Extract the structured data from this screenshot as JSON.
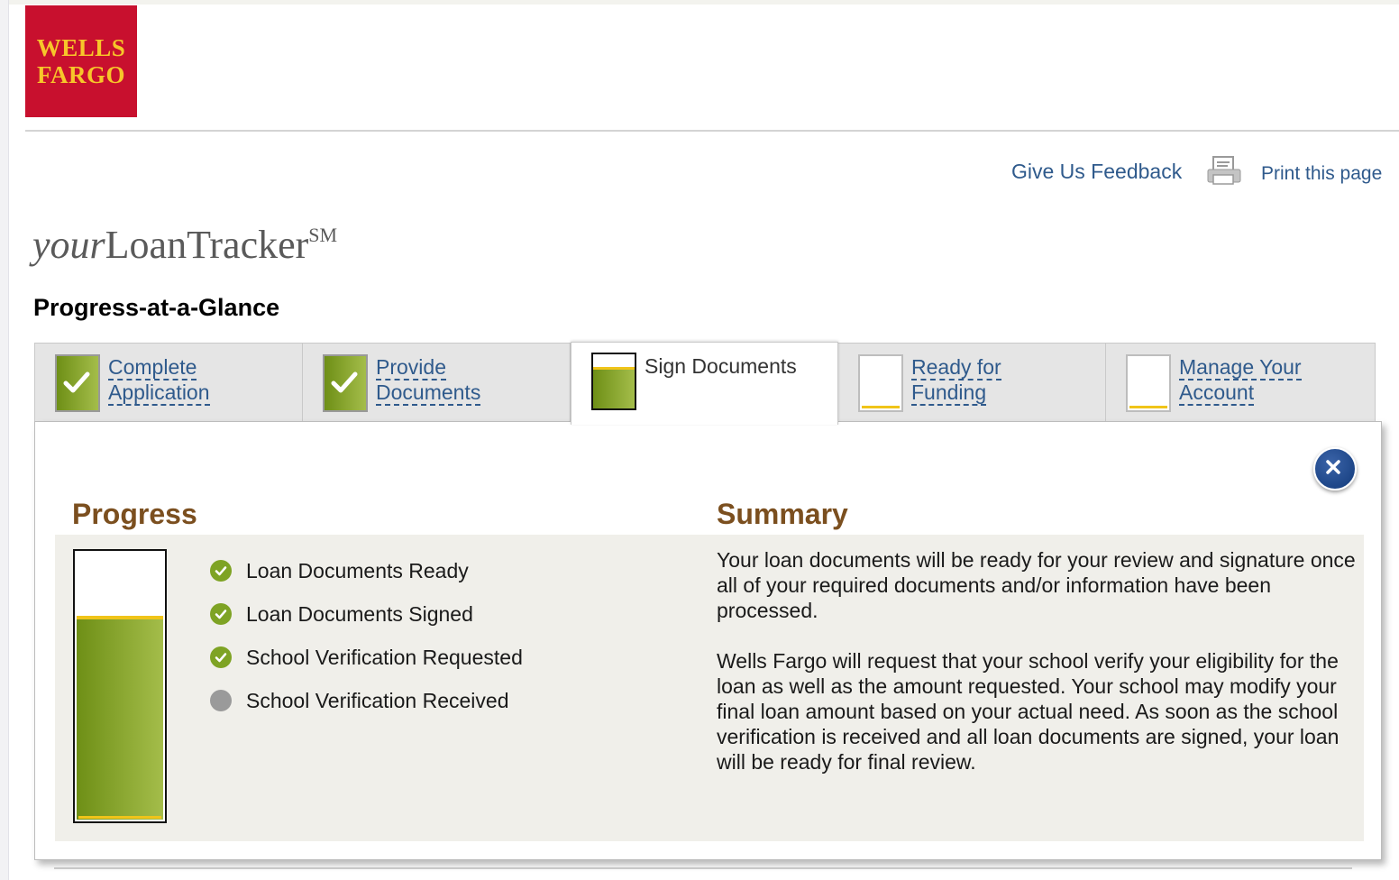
{
  "brand": {
    "logo_line1": "WELLS",
    "logo_line2": "FARGO"
  },
  "header": {
    "feedback_label": "Give Us Feedback",
    "print_label": "Print this page",
    "print_icon": "printer-icon"
  },
  "app": {
    "title_italic": "your",
    "title_main": "LoanTracker",
    "title_mark": "SM"
  },
  "glance": {
    "title": "Progress-at-a-Glance",
    "tabs": [
      {
        "line1": "Complete",
        "line2": "Application",
        "status": "complete"
      },
      {
        "line1": "Provide",
        "line2": "Documents",
        "status": "complete"
      },
      {
        "line1": "Sign Documents",
        "line2": "",
        "status": "current"
      },
      {
        "line1": "Ready for",
        "line2": "Funding",
        "status": "not-started"
      },
      {
        "line1": "Manage Your",
        "line2": "Account",
        "status": "not-started"
      }
    ],
    "current_tab_fill_fraction": 0.72
  },
  "panel": {
    "close_icon": "close-icon",
    "progress_title": "Progress",
    "progress_fill_fraction": 0.74,
    "steps": [
      {
        "label": "Loan Documents Ready",
        "done": true
      },
      {
        "label": "Loan Documents Signed",
        "done": true
      },
      {
        "label": "School Verification Requested",
        "done": true
      },
      {
        "label": "School Verification Received",
        "done": false
      }
    ],
    "summary_title": "Summary",
    "summary_p1": "Your loan documents will be ready for your review and signature once all of your required documents and/or information have been processed.",
    "summary_p2": "Wells Fargo will request that your school verify your eligibility for the loan as well as the amount requested. Your school may modify your final loan amount based on your actual need. As soon as the school verification is received and all loan documents are signed, your loan will be ready for final review."
  },
  "colors": {
    "brand_red": "#c8102e",
    "brand_gold": "#f7c62a",
    "link_blue": "#2f5a8c",
    "heading_brown": "#7b4f1f",
    "progress_green": "#7ea324",
    "accent_yellow": "#f0c419"
  }
}
